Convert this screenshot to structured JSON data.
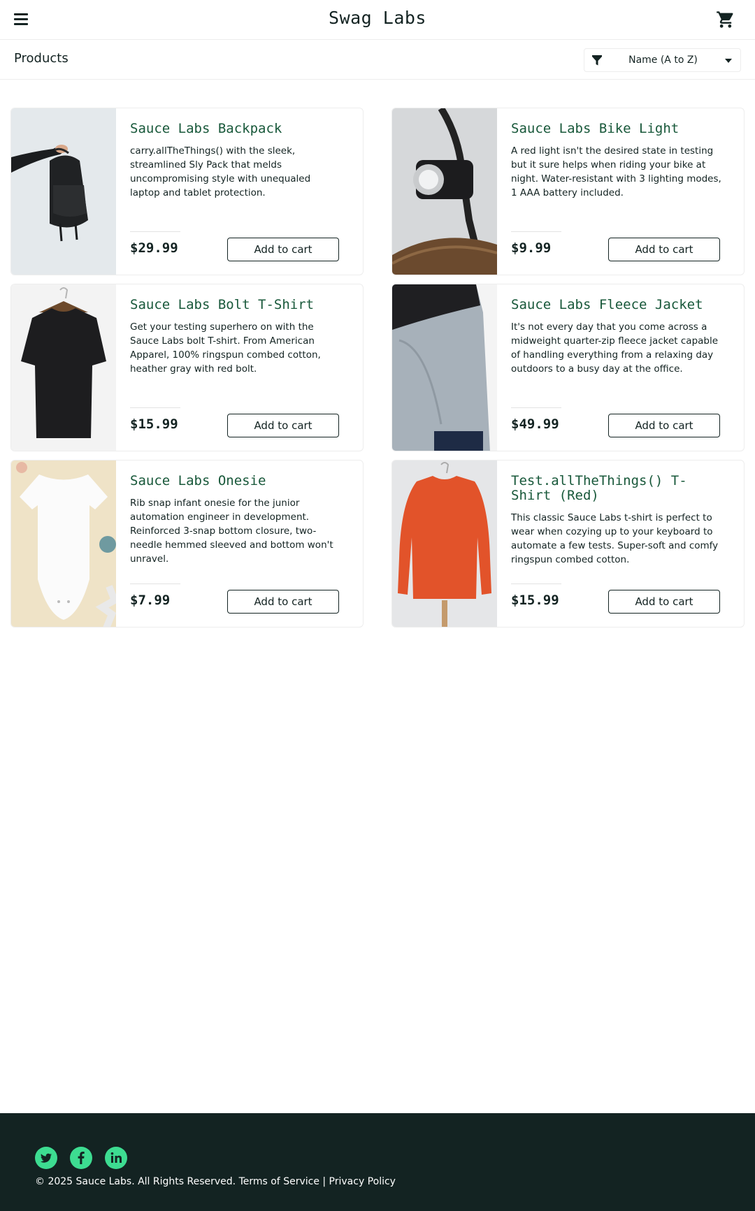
{
  "header": {
    "title": "Swag Labs",
    "menu_icon": "hamburger-menu-icon",
    "cart_icon": "shopping-cart-icon"
  },
  "sub_header": {
    "title": "Products",
    "sort": {
      "icon": "filter-icon",
      "selected": "Name (A to Z)"
    }
  },
  "products": [
    {
      "name": "Sauce Labs Backpack",
      "description": "carry.allTheThings() with the sleek, streamlined Sly Pack that melds uncompromising style with unequaled laptop and tablet protection.",
      "price": "$29.99",
      "button": "Add to cart"
    },
    {
      "name": "Sauce Labs Bike Light",
      "description": "A red light isn't the desired state in testing but it sure helps when riding your bike at night. Water-resistant with 3 lighting modes, 1 AAA battery included.",
      "price": "$9.99",
      "button": "Add to cart"
    },
    {
      "name": "Sauce Labs Bolt T-Shirt",
      "description": "Get your testing superhero on with the Sauce Labs bolt T-shirt. From American Apparel, 100% ringspun combed cotton, heather gray with red bolt.",
      "price": "$15.99",
      "button": "Add to cart"
    },
    {
      "name": "Sauce Labs Fleece Jacket",
      "description": "It's not every day that you come across a midweight quarter-zip fleece jacket capable of handling everything from a relaxing day outdoors to a busy day at the office.",
      "price": "$49.99",
      "button": "Add to cart"
    },
    {
      "name": "Sauce Labs Onesie",
      "description": "Rib snap infant onesie for the junior automation engineer in development. Reinforced 3-snap bottom closure, two-needle hemmed sleeved and bottom won't unravel.",
      "price": "$7.99",
      "button": "Add to cart"
    },
    {
      "name": "Test.allTheThings() T-Shirt (Red)",
      "description": "This classic Sauce Labs t-shirt is perfect to wear when cozying up to your keyboard to automate a few tests. Super-soft and comfy ringspun combed cotton.",
      "price": "$15.99",
      "button": "Add to cart"
    }
  ],
  "footer": {
    "social": [
      "twitter-icon",
      "facebook-icon",
      "linkedin-icon"
    ],
    "copyright": "© 2025 Sauce Labs. All Rights Reserved. Terms of Service | Privacy Policy"
  },
  "colors": {
    "brand_dark": "#132322",
    "product_name": "#18583a",
    "social_accent": "#3ddc91"
  }
}
